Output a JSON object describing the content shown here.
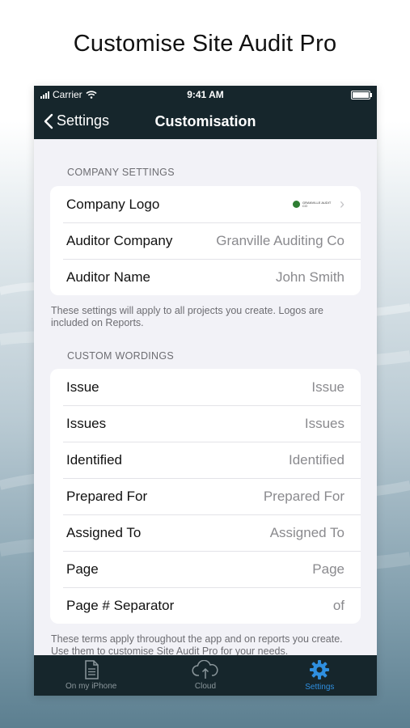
{
  "marketing": {
    "title": "Customise Site Audit Pro"
  },
  "status_bar": {
    "carrier": "Carrier",
    "time": "9:41 AM"
  },
  "nav": {
    "back_label": "Settings",
    "title": "Customisation"
  },
  "company_settings": {
    "header": "COMPANY SETTINGS",
    "rows": [
      {
        "label": "Company Logo",
        "logo_text": "GRANVILLE AUDIT CO"
      },
      {
        "label": "Auditor Company",
        "value": "Granville Auditing Co"
      },
      {
        "label": "Auditor Name",
        "value": "John Smith"
      }
    ],
    "footer": "These settings will apply to all projects you create. Logos are included on Reports."
  },
  "custom_wordings": {
    "header": "CUSTOM WORDINGS",
    "rows": [
      {
        "label": "Issue",
        "value": "Issue"
      },
      {
        "label": "Issues",
        "value": "Issues"
      },
      {
        "label": "Identified",
        "value": "Identified"
      },
      {
        "label": "Prepared For",
        "value": "Prepared For"
      },
      {
        "label": "Assigned To",
        "value": "Assigned To"
      },
      {
        "label": "Page",
        "value": "Page"
      },
      {
        "label": "Page # Separator",
        "value": "of"
      }
    ],
    "footer": "These terms apply throughout the app and on reports you create. Use them to customise Site Audit Pro for your needs."
  },
  "tab_bar": {
    "tabs": [
      {
        "label": "On my iPhone",
        "icon": "document-icon"
      },
      {
        "label": "Cloud",
        "icon": "cloud-icon"
      },
      {
        "label": "Settings",
        "icon": "gear-icon"
      }
    ],
    "active_color": "#2f8fe0"
  },
  "colors": {
    "bar_background": "#16262c",
    "screen_background": "#f2f2f7"
  }
}
